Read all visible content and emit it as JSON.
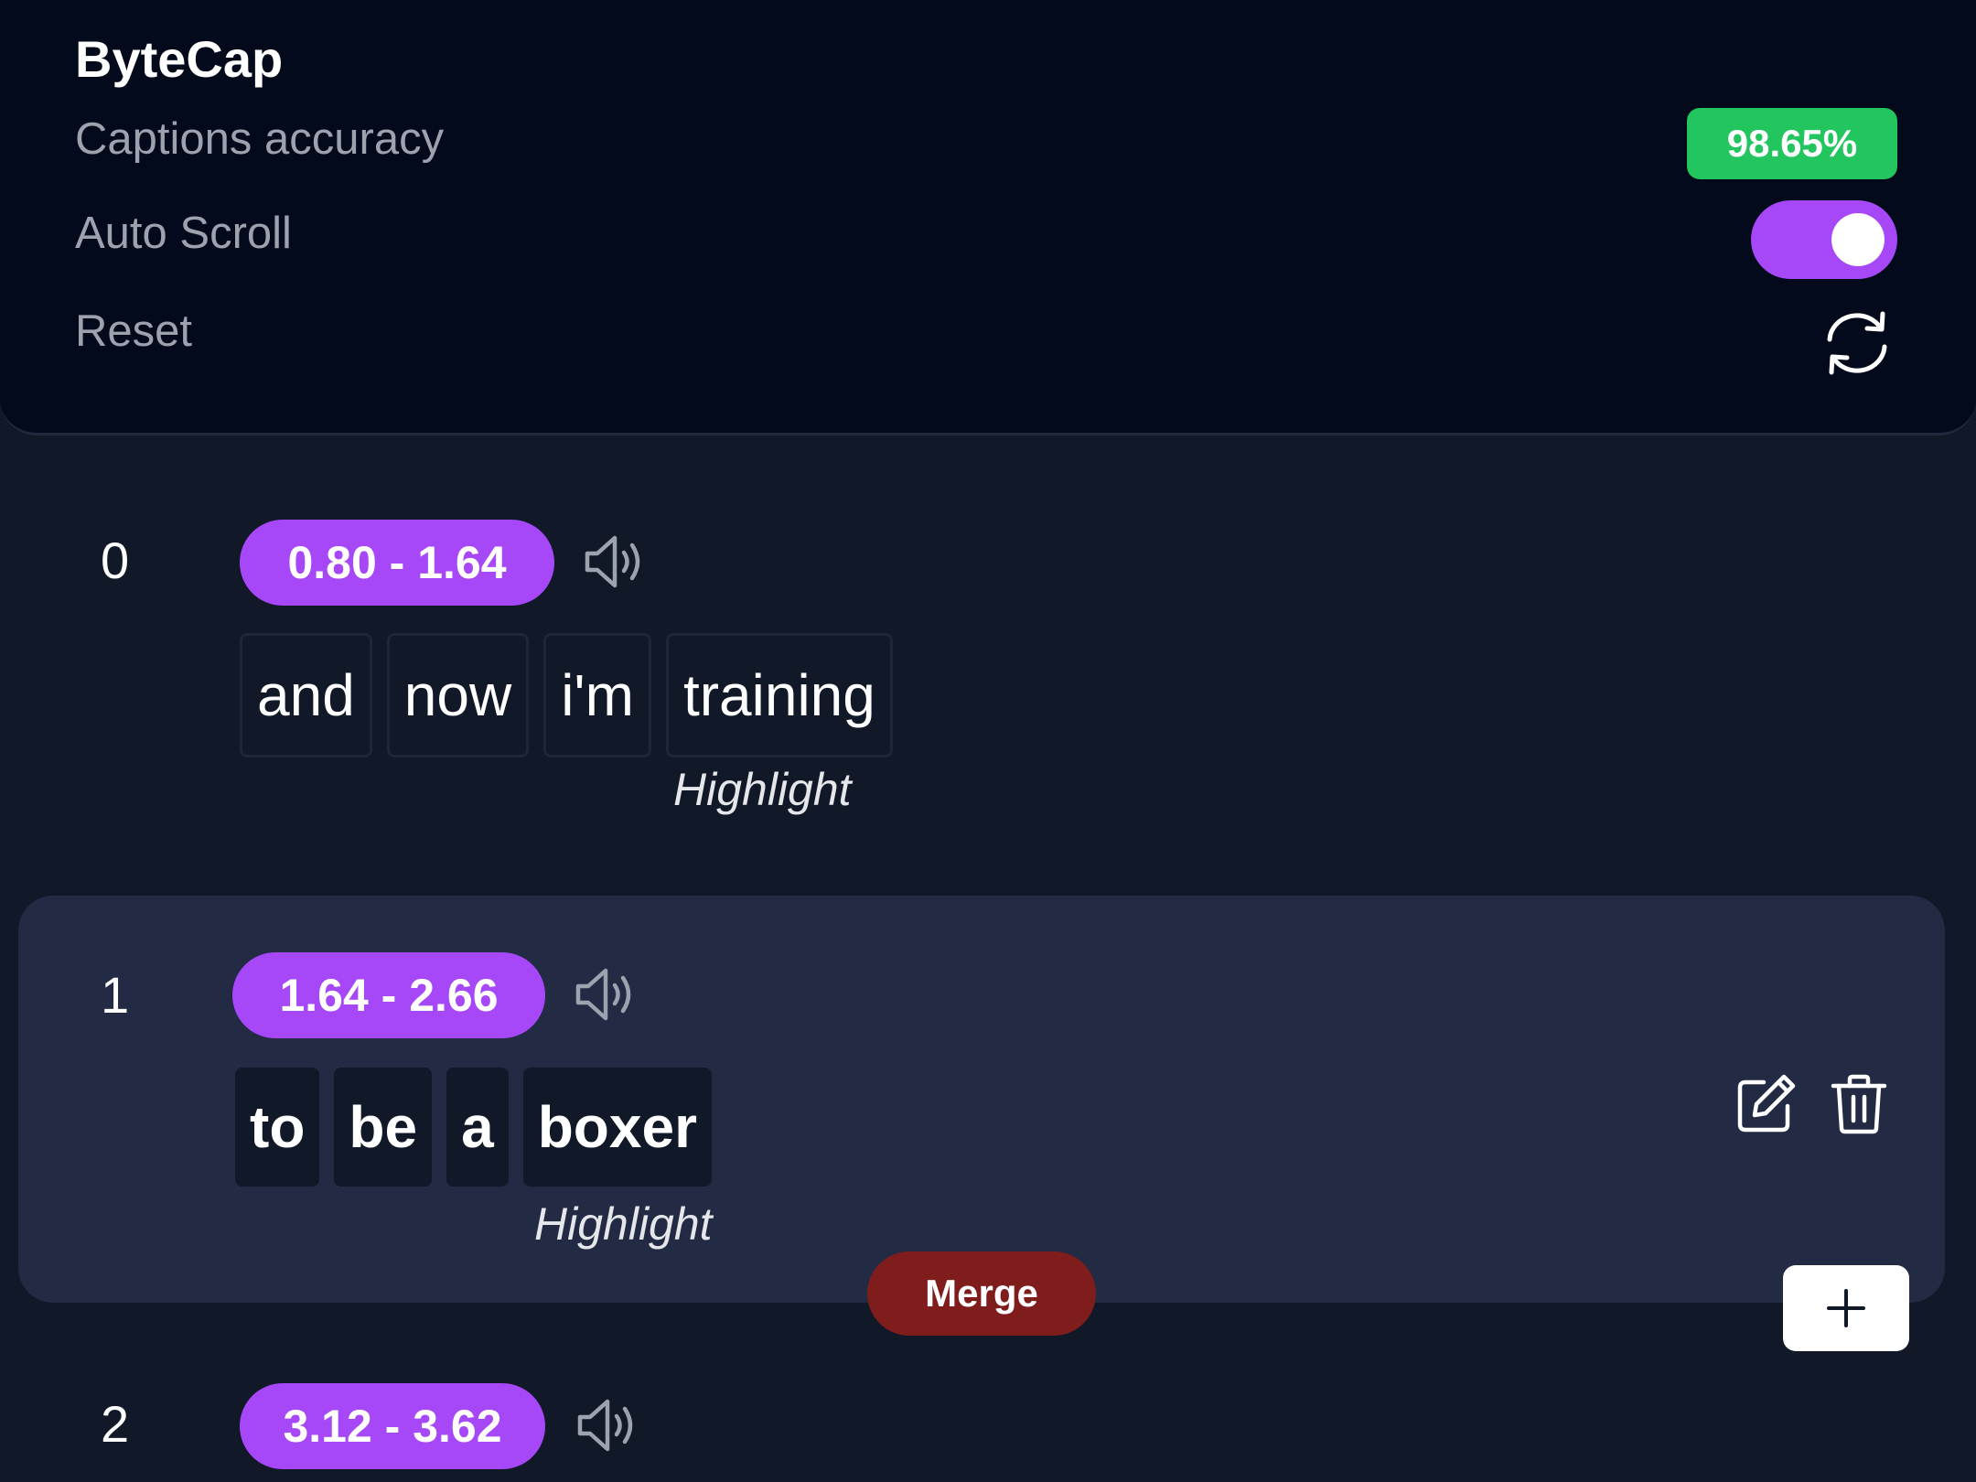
{
  "app": {
    "title": "ByteCap"
  },
  "settings": {
    "accuracy_label": "Captions accuracy",
    "accuracy_value": "98.65%",
    "auto_scroll_label": "Auto Scroll",
    "auto_scroll_on": true,
    "reset_label": "Reset"
  },
  "captions": [
    {
      "index": "0",
      "time": "0.80 - 1.64",
      "words": [
        "and",
        "now",
        "i'm",
        "training"
      ],
      "highlight": "Highlight",
      "selected": false
    },
    {
      "index": "1",
      "time": "1.64 - 2.66",
      "words": [
        "to",
        "be",
        "a",
        "boxer"
      ],
      "highlight": "Highlight",
      "selected": true
    },
    {
      "index": "2",
      "time": "3.12 - 3.62",
      "words": [],
      "highlight": "",
      "selected": false
    }
  ],
  "actions": {
    "merge_label": "Merge",
    "add_symbol": "+"
  },
  "icons": {
    "reset": "refresh-icon",
    "speaker": "speaker-icon",
    "edit": "pencil-icon",
    "delete": "trash-icon",
    "add": "plus-icon"
  },
  "colors": {
    "accent": "#a648f7",
    "accuracy": "#22c55e",
    "merge": "#7f1d1d",
    "header_bg": "#030a1b",
    "page_bg": "#111827",
    "selected_row_bg": "#222a44"
  }
}
